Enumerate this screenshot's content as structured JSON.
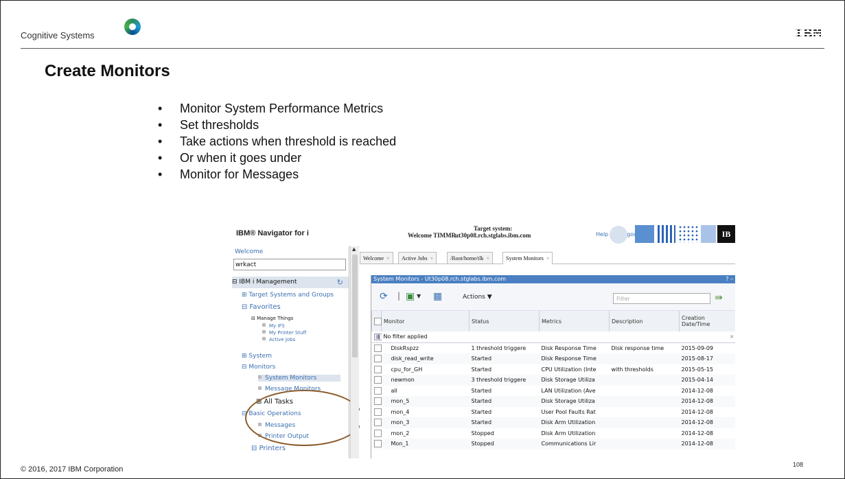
{
  "slide": {
    "brand": "Cognitive Systems",
    "ibm_logo": "IBM",
    "title": "Create Monitors",
    "bullets": [
      "Monitor System Performance Metrics",
      "Set thresholds",
      "Take actions when threshold is reached",
      "Or when it goes under",
      "Monitor for Messages"
    ],
    "copyright": "© 2016, 2017 IBM Corporation",
    "page_number": "108"
  },
  "app": {
    "title": "IBM® Navigator for i",
    "welcome": "Welcome TIMMR",
    "target_label": "Target system:",
    "target_host": "ut30p08.rch.stglabs.ibm.com",
    "help": "Help",
    "separator": "|",
    "logout": "Logout",
    "banner_text": "IB"
  },
  "nav": {
    "welcome": "Welcome",
    "search_value": "wrkact",
    "mgmt": "⊟ IBM i Management",
    "items": [
      {
        "label": "⊞ Target Systems and Groups"
      },
      {
        "label": "⊟ Favorites"
      },
      {
        "label": "⊟ Manage Things"
      },
      {
        "label": "My IFS"
      },
      {
        "label": "My Printer Stuff"
      },
      {
        "label": "Active Jobs"
      },
      {
        "label": "⊞ System"
      },
      {
        "label": "⊟ Monitors"
      },
      {
        "label": "System Monitors"
      },
      {
        "label": "Message Monitors"
      },
      {
        "label": "⊞ All Tasks"
      },
      {
        "label": "⊟ Basic Operations"
      },
      {
        "label": "Messages"
      },
      {
        "label": "Printer Output"
      },
      {
        "label": "⊟ Printers"
      }
    ]
  },
  "tabs": [
    {
      "label": "Welcome"
    },
    {
      "label": "Active Jobs"
    },
    {
      "label": "/Root/home/tlk"
    },
    {
      "label": "System Monitors"
    }
  ],
  "panel": {
    "title": "System Monitors - Ut30p08.rch.stglabs.ibm.com",
    "controls": "? –",
    "actions": "Actions ▼",
    "filter_placeholder": "Filter",
    "filter_status": "No filter applied",
    "filter_btn": "⇶ ...",
    "filter_close": "×",
    "columns": [
      "Monitor",
      "Status",
      "Metrics",
      "Description",
      "Creation Date/Time"
    ],
    "rows": [
      [
        "DiskRspzz",
        "1 threshold triggere",
        "Disk Response Time",
        "Disk response time",
        "2015-09-09"
      ],
      [
        "disk_read_write",
        "Started",
        "Disk Response Time",
        "",
        "2015-08-17"
      ],
      [
        "cpu_for_GH",
        "Started",
        "CPU Utilization (Inte",
        "with thresholds",
        "2015-05-15"
      ],
      [
        "newmon",
        "3 threshold triggere",
        "Disk Storage Utiliza",
        "",
        "2015-04-14"
      ],
      [
        "all",
        "Started",
        "LAN Utilization (Ave",
        "",
        "2014-12-08"
      ],
      [
        "mon_5",
        "Started",
        "Disk Storage Utiliza",
        "",
        "2014-12-08"
      ],
      [
        "mon_4",
        "Started",
        "User Pool Faults Rat",
        "",
        "2014-12-08"
      ],
      [
        "mon_3",
        "Started",
        "Disk Arm Utilization",
        "",
        "2014-12-08"
      ],
      [
        "mon_2",
        "Stopped",
        "Disk Arm Utilization",
        "",
        "2014-12-08"
      ],
      [
        "Mon_1",
        "Stopped",
        "Communications Lir",
        "",
        "2014-12-08"
      ]
    ]
  },
  "colors": {
    "panel_title": "#4a7fc1",
    "link": "#3a6fb0",
    "highlight_circle": "#8b5a2b"
  }
}
